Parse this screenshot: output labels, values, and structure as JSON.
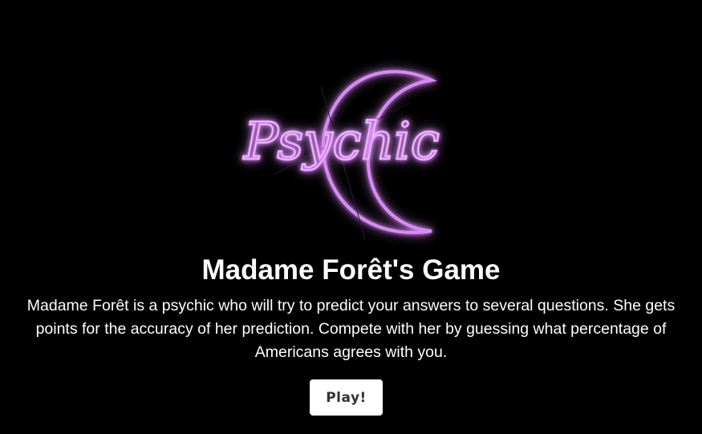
{
  "logo": {
    "text": "Psychic",
    "icon": "crescent-moon-icon",
    "neon_color": "#da8cf6"
  },
  "game": {
    "title": "Madame Forêt's Game",
    "description": "Madame Forêt is a psychic who will try to predict your answers to several questions. She gets points for the accuracy of her prediction. Compete with her by guessing what percentage of Americans agrees with you.",
    "play_label": "Play!"
  }
}
